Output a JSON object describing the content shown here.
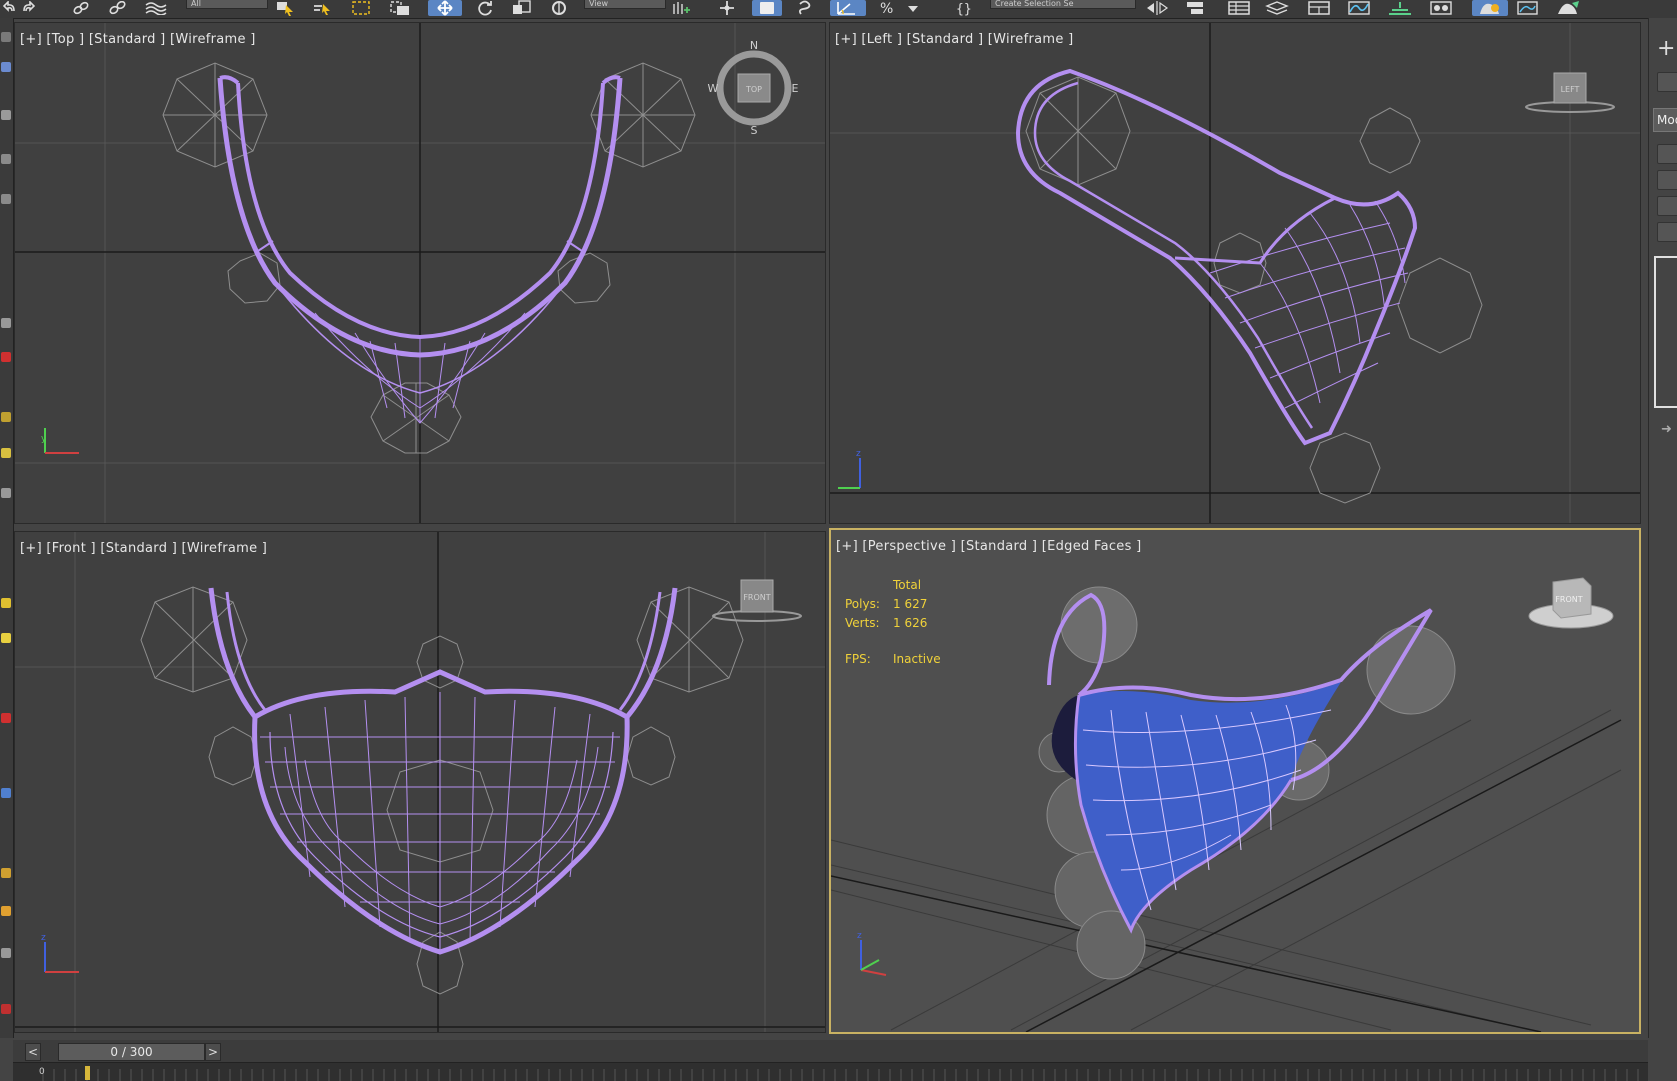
{
  "colors": {
    "viewport_bg": "#404040",
    "perspective_bg": "#4f4f4f",
    "wire": "#b48ff0",
    "active_border": "#c9b263",
    "stats_text": "#f0d23a",
    "mask_fill": "#3f5fc9"
  },
  "toolbar": {
    "icons": [
      "undo-icon",
      "redo-icon",
      "link-icon",
      "unlink-icon",
      "bind-space-warp-icon",
      "selection-filter-field",
      "select-object-icon",
      "select-by-name-icon",
      "rectangular-selection-icon",
      "window-crossing-icon",
      "select-and-move-icon",
      "select-and-rotate-icon",
      "select-and-scale-icon",
      "select-and-place-icon",
      "reference-coordinate-field",
      "use-pivot-center-icon",
      "select-and-manipulate-icon",
      "keyboard-shortcut-override-icon",
      "snaps-toggle-icon",
      "angle-snap-icon",
      "percent-snap-icon",
      "spinner-snap-icon",
      "edit-named-selection-icon",
      "named-selection-set-field",
      "mirror-icon",
      "align-icon",
      "toggle-scene-explorer-icon",
      "toggle-layer-explorer-icon",
      "toggle-ribbon-icon",
      "curve-editor-icon",
      "schematic-view-icon",
      "material-editor-icon",
      "render-setup-icon",
      "rendered-frame-window-icon",
      "render-production-icon"
    ],
    "selection_filter": "All",
    "reference_coordinate": "View",
    "named_selection": "Create Selection Se"
  },
  "viewports": {
    "top": {
      "label": "[+] [Top ] [Standard ] [Wireframe ]",
      "viewcube": "TOP",
      "compass": {
        "n": "N",
        "s": "S",
        "e": "E",
        "w": "W"
      }
    },
    "left": {
      "label": "[+] [Left ] [Standard ] [Wireframe ]",
      "viewcube": "LEFT"
    },
    "front": {
      "label": "[+] [Front ] [Standard ] [Wireframe ]",
      "viewcube": "FRONT"
    },
    "perspective": {
      "label": "[+] [Perspective ] [Standard ] [Edged Faces ]",
      "viewcube": "FRONT",
      "stats": {
        "total_label": "Total",
        "polys_label": "Polys:",
        "polys": "1 627",
        "verts_label": "Verts:",
        "verts": "1 626",
        "fps_label": "FPS:",
        "fps": "Inactive"
      }
    }
  },
  "axis": {
    "x": "x",
    "y": "y",
    "z": "z"
  },
  "timeline": {
    "frame": "0 / 300",
    "prev": "<",
    "next": ">",
    "ruler_start": "0"
  },
  "command_panel": {
    "create_icon": "+",
    "modifier_list": "Mod"
  }
}
